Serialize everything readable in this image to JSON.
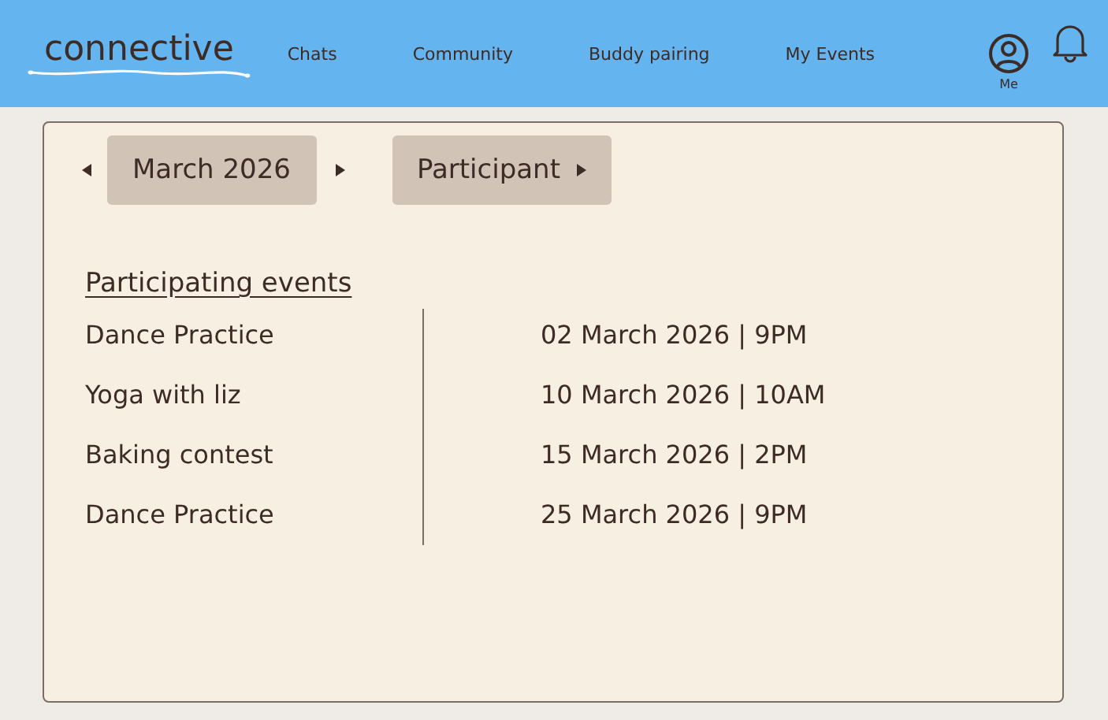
{
  "header": {
    "logo": "connective",
    "nav": [
      {
        "label": "Chats",
        "selected": false
      },
      {
        "label": "Community",
        "selected": false
      },
      {
        "label": "Buddy pairing",
        "selected": false
      },
      {
        "label": "My Events",
        "selected": false
      }
    ],
    "profile_label": "Me"
  },
  "controls": {
    "month": "March 2026",
    "role": "Participant"
  },
  "section_title": "Participating events",
  "events": [
    {
      "name": "Dance Practice",
      "when": "02 March 2026 | 9PM"
    },
    {
      "name": "Yoga with liz",
      "when": "10 March 2026 | 10AM"
    },
    {
      "name": "Baking contest",
      "when": "15 March 2026 | 2PM"
    },
    {
      "name": "Dance Practice",
      "when": "25 March 2026 | 9PM"
    }
  ]
}
